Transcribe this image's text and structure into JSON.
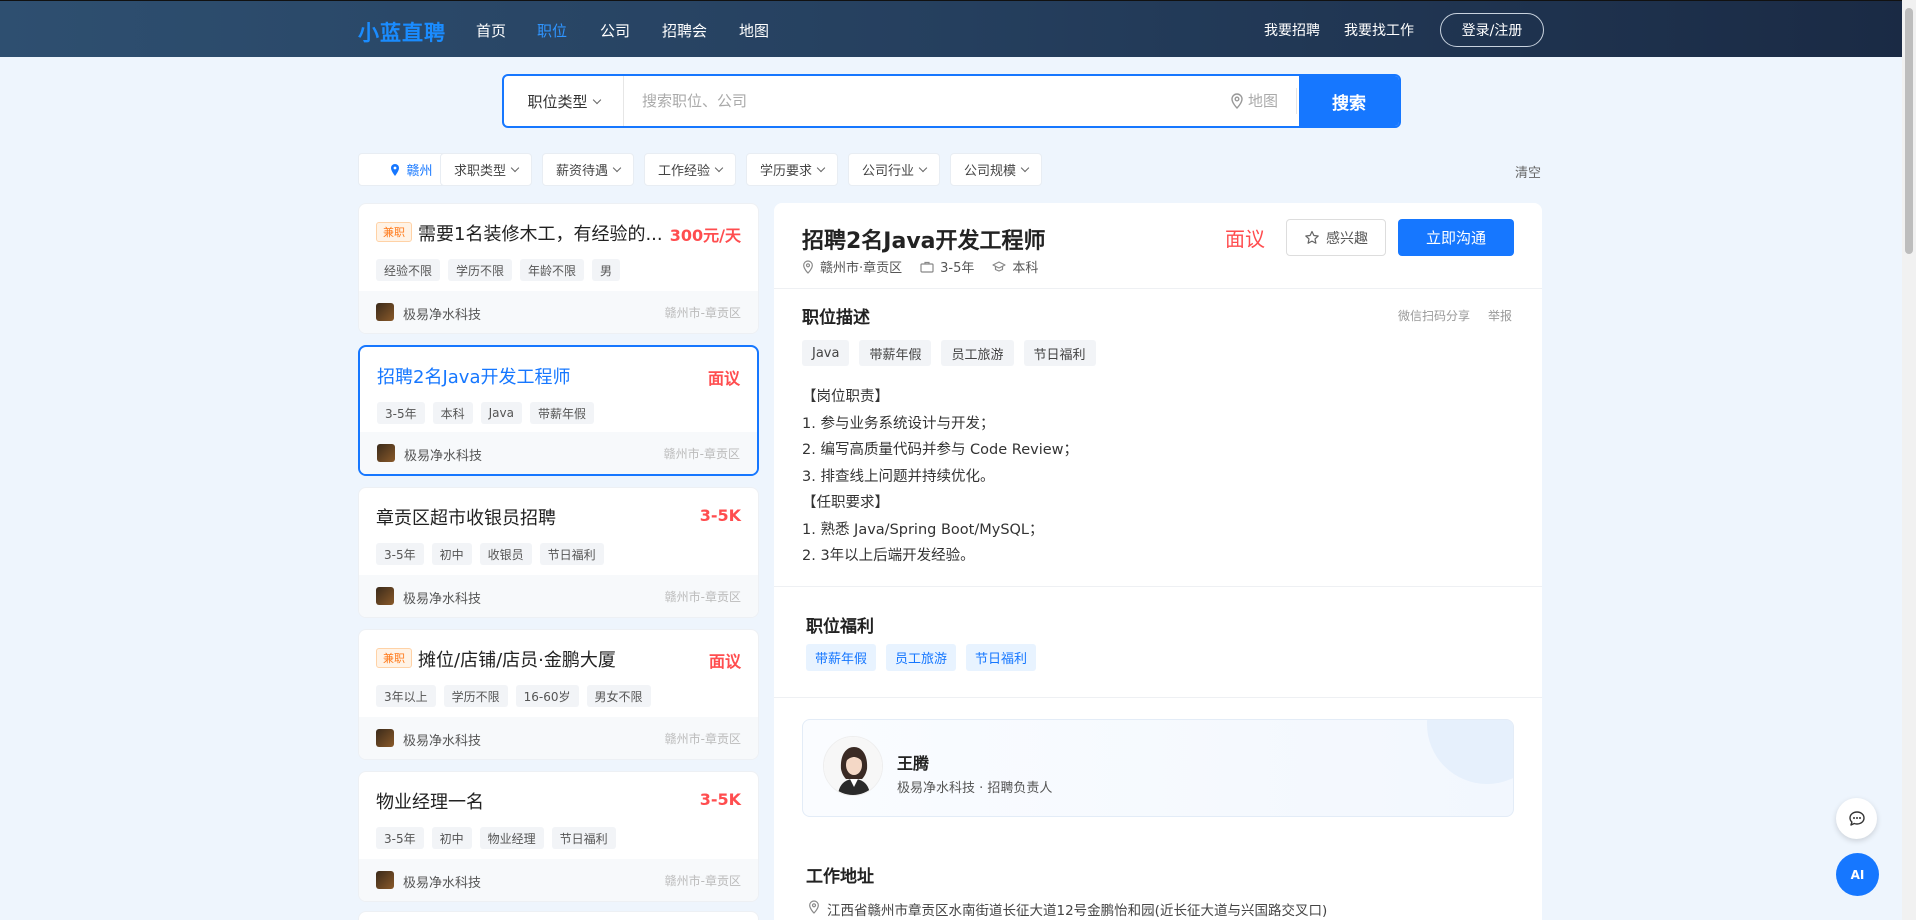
{
  "header": {
    "logo": "小蓝直聘",
    "nav": [
      "首页",
      "职位",
      "公司",
      "招聘会",
      "地图"
    ],
    "active_nav_index": 1,
    "links": [
      "我要招聘",
      "我要找工作"
    ],
    "login_label": "登录/注册"
  },
  "search": {
    "type_label": "职位类型",
    "placeholder": "搜索职位、公司",
    "map_label": "地图",
    "button_label": "搜索"
  },
  "filters": {
    "city": "赣州",
    "items": [
      "求职类型",
      "薪资待遇",
      "工作经验",
      "学历要求",
      "公司行业",
      "公司规模"
    ],
    "clear_label": "清空"
  },
  "jobs": [
    {
      "badge": "兼职",
      "title": "需要1名装修木工，有经验的...",
      "salary": "300元/天",
      "tags": [
        "经验不限",
        "学历不限",
        "年龄不限",
        "男"
      ],
      "company": "极易净水科技",
      "location": "赣州市-章贡区"
    },
    {
      "badge": "",
      "title": "招聘2名Java开发工程师",
      "salary": "面议",
      "tags": [
        "3-5年",
        "本科",
        "Java",
        "带薪年假"
      ],
      "company": "极易净水科技",
      "location": "赣州市-章贡区"
    },
    {
      "badge": "",
      "title": "章贡区超市收银员招聘",
      "salary": "3-5K",
      "tags": [
        "3-5年",
        "初中",
        "收银员",
        "节日福利"
      ],
      "company": "极易净水科技",
      "location": "赣州市-章贡区"
    },
    {
      "badge": "兼职",
      "title": "摊位/店铺/店员·金鹏大厦",
      "salary": "面议",
      "tags": [
        "3年以上",
        "学历不限",
        "16-60岁",
        "男女不限"
      ],
      "company": "极易净水科技",
      "location": "赣州市-章贡区"
    },
    {
      "badge": "",
      "title": "物业经理一名",
      "salary": "3-5K",
      "tags": [
        "3-5年",
        "初中",
        "物业经理",
        "节日福利"
      ],
      "company": "极易净水科技",
      "location": "赣州市-章贡区"
    }
  ],
  "detail": {
    "title": "招聘2名Java开发工程师",
    "salary": "面议",
    "interest_label": "感兴趣",
    "chat_label": "立即沟通",
    "meta": {
      "location": "赣州市·章贡区",
      "experience": "3-5年",
      "education": "本科"
    },
    "desc_title": "职位描述",
    "share_label": "微信扫码分享",
    "report_label": "举报",
    "tags": [
      "Java",
      "带薪年假",
      "员工旅游",
      "节日福利"
    ],
    "description": [
      "【岗位职责】",
      "1. 参与业务系统设计与开发；",
      "2. 编写高质量代码并参与 Code Review；",
      "3. 排查线上问题并持续优化。",
      "【任职要求】",
      "1. 熟悉 Java/Spring Boot/MySQL；",
      "2. 3年以上后端开发经验。"
    ],
    "welfare_title": "职位福利",
    "welfare": [
      "带薪年假",
      "员工旅游",
      "节日福利"
    ],
    "recruiter": {
      "name": "王腾",
      "company": "极易净水科技",
      "role": "招聘负责人"
    },
    "address_title": "工作地址",
    "address": "江西省赣州市章贡区水南街道长征大道12号金鹏怡和园(近长征大道与兴国路交叉口)"
  },
  "floating": {
    "ai_label": "AI"
  },
  "colors": {
    "primary": "#1677ff",
    "salary": "#ff4d4f",
    "header_bg": "#2e4f70"
  }
}
